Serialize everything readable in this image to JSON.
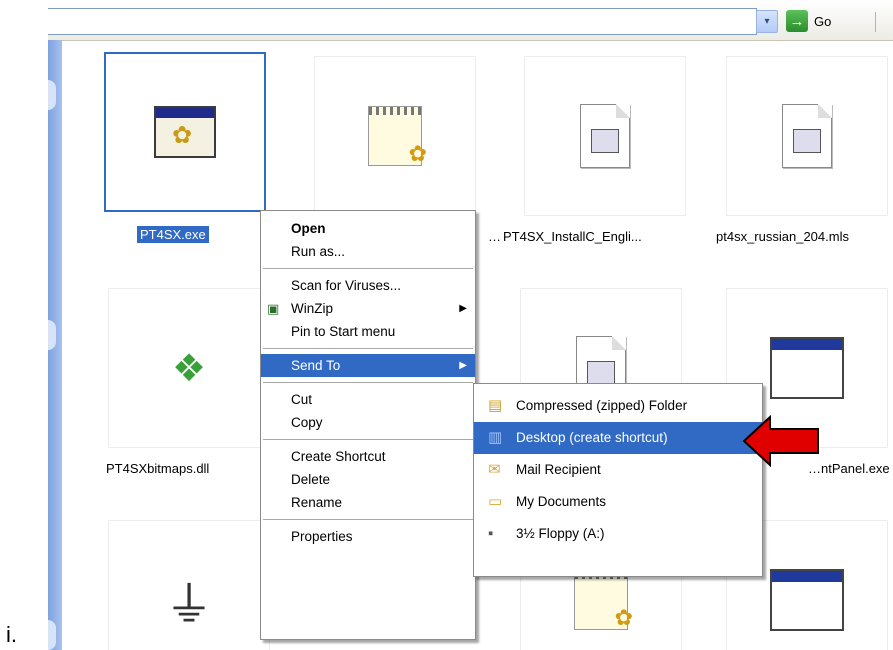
{
  "caption": "i.",
  "toolbar": {
    "go_label": "Go",
    "dropdown_glyph": "▾",
    "go_glyph": "→"
  },
  "files": [
    {
      "name": "PT4SX.exe",
      "icon": "exe-gear-icon"
    },
    {
      "name": "…",
      "icon": "notepad-gear-icon"
    },
    {
      "name": "PT4SX_InstallC_Engli...",
      "icon": "document-icon"
    },
    {
      "name": "pt4sx_russian_204.mls",
      "icon": "document-icon"
    },
    {
      "name": "PT4SXbitmaps.dll",
      "icon": "dll-icon"
    },
    {
      "name": "…ntPanel.exe",
      "icon": "window-icon"
    }
  ],
  "context_menu": {
    "items": [
      {
        "label": "Open"
      },
      {
        "label": "Run as..."
      },
      {
        "label": "Scan for Viruses..."
      },
      {
        "label": "WinZip"
      },
      {
        "label": "Pin to Start menu"
      },
      {
        "label": "Send To"
      },
      {
        "label": "Cut"
      },
      {
        "label": "Copy"
      },
      {
        "label": "Create Shortcut"
      },
      {
        "label": "Delete"
      },
      {
        "label": "Rename"
      },
      {
        "label": "Properties"
      }
    ]
  },
  "send_to_menu": {
    "items": [
      {
        "label": "Compressed (zipped) Folder",
        "icon": "zip-folder-icon"
      },
      {
        "label": "Desktop (create shortcut)",
        "icon": "desktop-icon"
      },
      {
        "label": "Mail Recipient",
        "icon": "mail-icon"
      },
      {
        "label": "My Documents",
        "icon": "folder-icon"
      },
      {
        "label": "3½ Floppy (A:)",
        "icon": "floppy-icon"
      }
    ]
  },
  "colors": {
    "selection": "#316ac5",
    "arrow": "#e00000"
  }
}
